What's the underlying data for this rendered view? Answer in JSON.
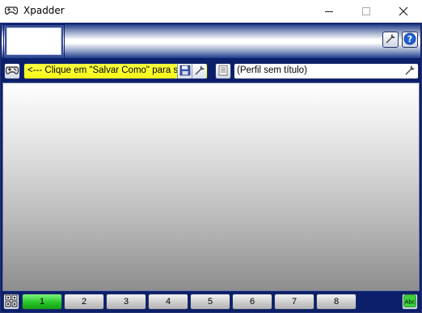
{
  "window": {
    "title": "Xpadder",
    "controls": {
      "minimize": "minimize",
      "maximize": "maximize",
      "close": "close"
    }
  },
  "toolbar": {
    "save_hint": "<--- Clique em \"Salvar Como\" para salvar",
    "profile_name": "(Perfil sem título)"
  },
  "pages": {
    "items": [
      "1",
      "2",
      "3",
      "4",
      "5",
      "6",
      "7",
      "8"
    ],
    "active_index": 0
  },
  "icons": {
    "app": "gamepad-icon",
    "settings": "wrench-icon",
    "help": "help-icon",
    "controller": "controller-icon",
    "save": "floppy-disk-icon",
    "profile_list": "list-icon",
    "layout": "grid-icon",
    "text": "abc-icon"
  },
  "colors": {
    "frame": "#0b1f6b",
    "highlight_field": "#ffff2a",
    "active_page": "#28c428"
  }
}
